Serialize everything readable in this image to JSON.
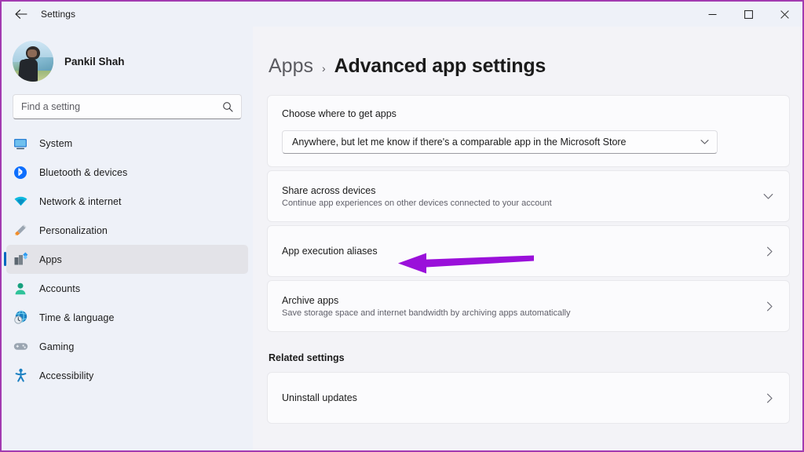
{
  "window": {
    "title": "Settings",
    "back_icon": "back-arrow-icon",
    "controls": [
      {
        "name": "minimize",
        "glyph": "—"
      },
      {
        "name": "maximize",
        "glyph": "□"
      },
      {
        "name": "close",
        "glyph": "✕"
      }
    ]
  },
  "sidebar": {
    "profile": {
      "name": "Pankil Shah",
      "avatar": "user-avatar"
    },
    "search": {
      "placeholder": "Find a setting",
      "value": "",
      "icon": "search-icon"
    },
    "items": [
      {
        "label": "System",
        "icon": "monitor-icon",
        "selected": false
      },
      {
        "label": "Bluetooth & devices",
        "icon": "bluetooth-icon",
        "selected": false
      },
      {
        "label": "Network & internet",
        "icon": "wifi-icon",
        "selected": false
      },
      {
        "label": "Personalization",
        "icon": "paintbrush-icon",
        "selected": false
      },
      {
        "label": "Apps",
        "icon": "apps-icon",
        "selected": true
      },
      {
        "label": "Accounts",
        "icon": "person-icon",
        "selected": false
      },
      {
        "label": "Time & language",
        "icon": "clock-globe-icon",
        "selected": false
      },
      {
        "label": "Gaming",
        "icon": "gamepad-icon",
        "selected": false
      },
      {
        "label": "Accessibility",
        "icon": "accessibility-icon",
        "selected": false
      }
    ]
  },
  "main": {
    "breadcrumb": {
      "parent": "Apps",
      "separator": "›",
      "current": "Advanced app settings"
    },
    "choose_where": {
      "label": "Choose where to get apps",
      "dropdown_value": "Anywhere, but let me know if there's a comparable app in the Microsoft Store",
      "dropdown_icon": "chevron-down-icon"
    },
    "rows": [
      {
        "title": "Share across devices",
        "subtitle": "Continue app experiences on other devices connected to your account",
        "chevron": "chevron-down-icon"
      },
      {
        "title": "App execution aliases",
        "subtitle": "",
        "chevron": "chevron-right-icon"
      },
      {
        "title": "Archive apps",
        "subtitle": "Save storage space and internet bandwidth by archiving apps automatically",
        "chevron": "chevron-right-icon"
      }
    ],
    "related_settings": {
      "heading": "Related settings",
      "rows": [
        {
          "title": "Uninstall updates",
          "subtitle": "",
          "chevron": "chevron-right-icon"
        }
      ]
    }
  },
  "annotation": {
    "type": "arrow",
    "points_to": "App execution aliases",
    "direction": "left",
    "color": "#9a10da"
  },
  "colors": {
    "accent": "#0067c0",
    "window_border": "#a23ab0",
    "sidebar_bg": "#eef1f8",
    "page_bg": "#f3f3f7",
    "card_bg": "#fbfbfd",
    "annotation": "#9a10da"
  }
}
